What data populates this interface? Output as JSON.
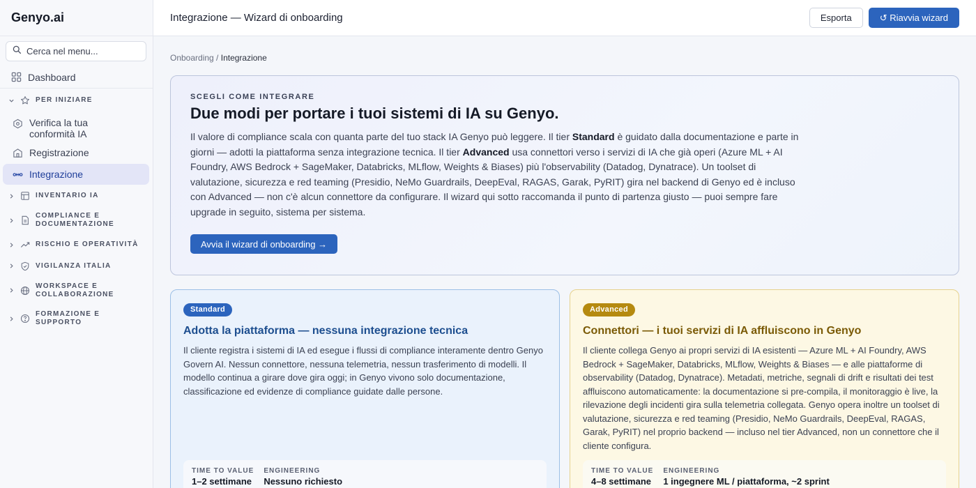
{
  "brand": "Genyo.ai",
  "search": {
    "placeholder": "Cerca nel menu..."
  },
  "sidebar": {
    "dashboard": "Dashboard",
    "sections": {
      "per_iniziare": "PER INIZIARE",
      "inventario": "INVENTARIO IA",
      "compliance_1": "COMPLIANCE E",
      "compliance_2": "DOCUMENTAZIONE",
      "rischio": "RISCHIO E OPERATIVITÀ",
      "vigilanza": "VIGILANZA ITALIA",
      "workspace_1": "WORKSPACE E",
      "workspace_2": "COLLABORAZIONE",
      "formazione_1": "FORMAZIONE E",
      "formazione_2": "SUPPORTO"
    },
    "items": {
      "verifica": "Verifica la tua conformità IA",
      "registrazione": "Registrazione",
      "integrazione": "Integrazione"
    }
  },
  "topbar": {
    "title": "Integrazione — Wizard di onboarding",
    "export": "Esporta",
    "restart": "↺ Riavvia wizard"
  },
  "breadcrumb": {
    "parent": "Onboarding",
    "sep": " / ",
    "current": "Integrazione"
  },
  "hero": {
    "eyebrow": "SCEGLI COME INTEGRARE",
    "title": "Due modi per portare i tuoi sistemi di IA su Genyo.",
    "p1": "Il valore di compliance scala con quanta parte del tuo stack IA Genyo può leggere. Il tier ",
    "b1": "Standard",
    "p2": " è guidato dalla documentazione e parte in giorni — adotti la piattaforma senza integrazione tecnica. Il tier ",
    "b2": "Advanced",
    "p3": " usa connettori verso i servizi di IA che già operi (Azure ML + AI Foundry, AWS Bedrock + SageMaker, Databricks, MLflow, Weights & Biases) più l'observability (Datadog, Dynatrace). Un toolset di valutazione, sicurezza e red teaming (Presidio, NeMo Guardrails, DeepEval, RAGAS, Garak, PyRIT) gira nel backend di Genyo ed è incluso con Advanced — non c'è alcun connettore da configurare. Il wizard qui sotto raccomanda il punto di partenza giusto — puoi sempre fare upgrade in seguito, sistema per sistema.",
    "cta": "Avvia il wizard di onboarding →"
  },
  "cards": {
    "standard": {
      "badge": "Standard",
      "title": "Adotta la piattaforma — nessuna integrazione tecnica",
      "body": "Il cliente registra i sistemi di IA ed esegue i flussi di compliance interamente dentro Genyo Govern AI. Nessun connettore, nessuna telemetria, nessun trasferimento di modelli. Il modello continua a girare dove gira oggi; in Genyo vivono solo documentazione, classificazione ed evidenze di compliance guidate dalle persone.",
      "ttv_label": "TIME TO VALUE",
      "ttv_value": "1–2 settimane",
      "eng_label": "ENGINEERING",
      "eng_value": "Nessuno richiesto"
    },
    "advanced": {
      "badge": "Advanced",
      "title": "Connettori — i tuoi servizi di IA affluiscono in Genyo",
      "body": "Il cliente collega Genyo ai propri servizi di IA esistenti — Azure ML + AI Foundry, AWS Bedrock + SageMaker, Databricks, MLflow, Weights & Biases — e alle piattaforme di observability (Datadog, Dynatrace). Metadati, metriche, segnali di drift e risultati dei test affluiscono automaticamente: la documentazione si pre-compila, il monitoraggio è live, la rilevazione degli incidenti gira sulla telemetria collegata. Genyo opera inoltre un toolset di valutazione, sicurezza e red teaming (Presidio, NeMo Guardrails, DeepEval, RAGAS, Garak, PyRIT) nel proprio backend — incluso nel tier Advanced, non un connettore che il cliente configura.",
      "ttv_label": "TIME TO VALUE",
      "ttv_value": "4–8 settimane",
      "eng_label": "ENGINEERING",
      "eng_value": "1 ingegnere ML / piattaforma, ~2 sprint"
    }
  },
  "colors": {
    "primary": "#2c64bd",
    "advanced": "#b58a10",
    "active_nav_bg": "#e3e5f7"
  }
}
